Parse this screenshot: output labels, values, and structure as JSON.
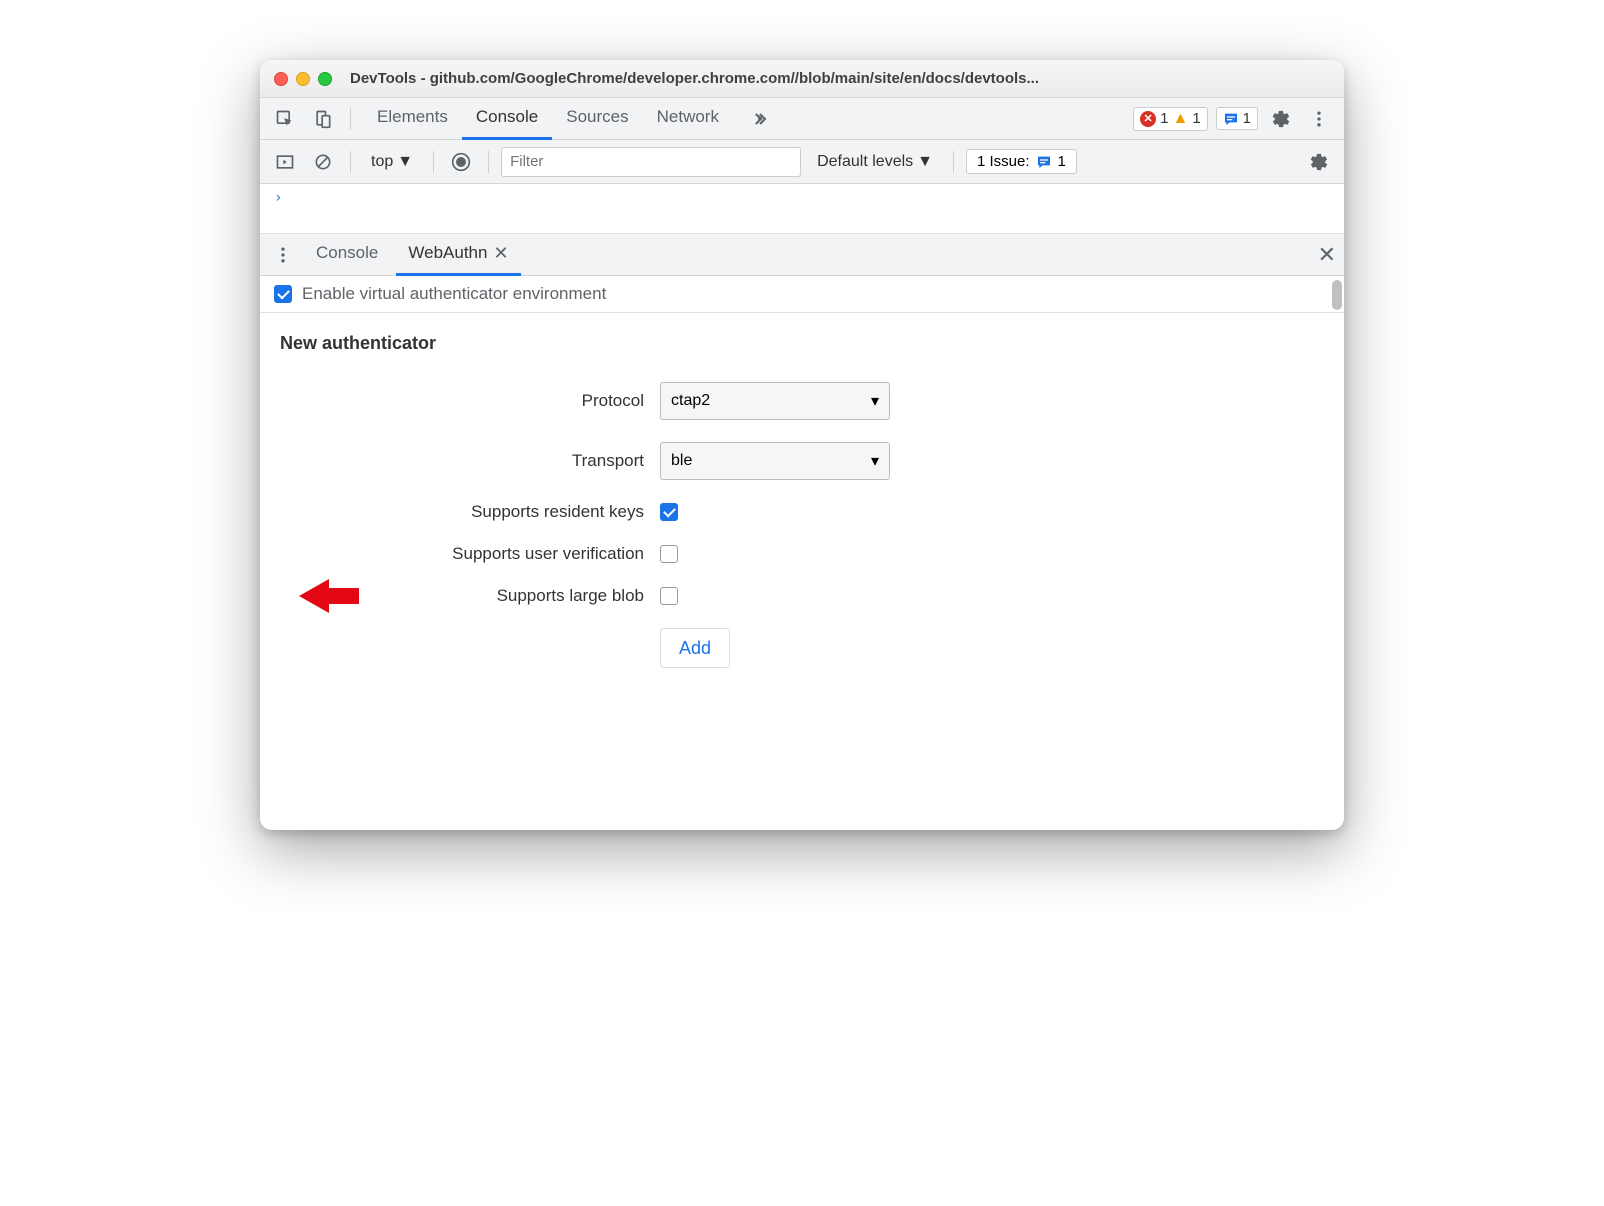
{
  "window": {
    "title": "DevTools - github.com/GoogleChrome/developer.chrome.com//blob/main/site/en/docs/devtools..."
  },
  "main_tabs": {
    "items": [
      "Elements",
      "Console",
      "Sources",
      "Network"
    ],
    "active": "Console"
  },
  "status_badges": {
    "errors": "1",
    "warnings": "1",
    "messages": "1"
  },
  "sub_toolbar": {
    "context": "top",
    "filter_placeholder": "Filter",
    "levels": "Default levels",
    "issues_prefix": "1 Issue:",
    "issues_count": "1"
  },
  "console_prompt": "›",
  "drawer": {
    "tabs": [
      "Console",
      "WebAuthn"
    ],
    "active": "WebAuthn",
    "enable_label": "Enable virtual authenticator environment",
    "enable_checked": true
  },
  "form": {
    "title": "New authenticator",
    "protocol_label": "Protocol",
    "protocol_value": "ctap2",
    "transport_label": "Transport",
    "transport_value": "ble",
    "resident_label": "Supports resident keys",
    "resident_checked": true,
    "userver_label": "Supports user verification",
    "userver_checked": false,
    "largeblob_label": "Supports large blob",
    "largeblob_checked": false,
    "add_button": "Add"
  }
}
